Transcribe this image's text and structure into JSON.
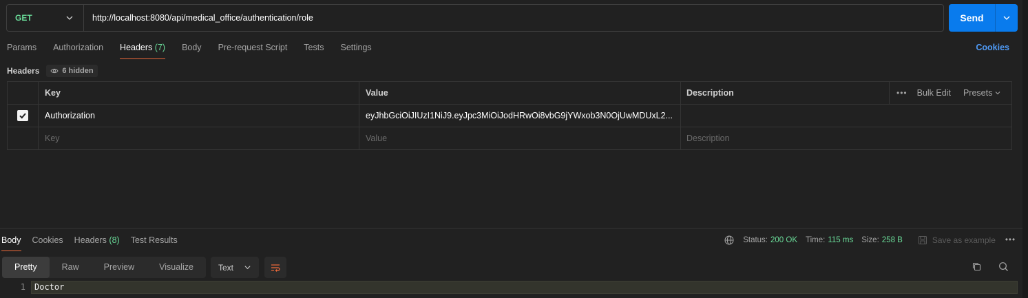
{
  "request": {
    "method": "GET",
    "url": "http://localhost:8080/api/medical_office/authentication/role",
    "send_label": "Send"
  },
  "tabs": [
    {
      "label": "Params"
    },
    {
      "label": "Authorization"
    },
    {
      "label": "Headers",
      "count": "(7)"
    },
    {
      "label": "Body"
    },
    {
      "label": "Pre-request Script"
    },
    {
      "label": "Tests"
    },
    {
      "label": "Settings"
    }
  ],
  "cookies_label": "Cookies",
  "headers_section": {
    "title": "Headers",
    "hidden_badge": "6 hidden",
    "columns": {
      "key": "Key",
      "value": "Value",
      "description": "Description"
    },
    "bulk_edit": "Bulk Edit",
    "presets": "Presets",
    "rows": [
      {
        "checked": true,
        "key": "Authorization",
        "value": "eyJhbGciOiJIUzI1NiJ9.eyJpc3MiOiJodHRwOi8vbG9jYWxob3N0OjUwMDUxL2..."
      }
    ],
    "placeholder": {
      "key": "Key",
      "value": "Value",
      "description": "Description"
    }
  },
  "response": {
    "tabs": [
      {
        "label": "Body"
      },
      {
        "label": "Cookies"
      },
      {
        "label": "Headers",
        "count": "(8)"
      },
      {
        "label": "Test Results"
      }
    ],
    "status_label": "Status:",
    "status_value": "200 OK",
    "time_label": "Time:",
    "time_value": "115 ms",
    "size_label": "Size:",
    "size_value": "258 B",
    "save_example": "Save as example",
    "format_tabs": [
      "Pretty",
      "Raw",
      "Preview",
      "Visualize"
    ],
    "format_select": "Text",
    "body_lines": [
      {
        "num": "1",
        "text": "Doctor"
      }
    ]
  },
  "colors": {
    "accent": "#097bed",
    "success": "#6bdd9a",
    "active_tab": "#f26b3a"
  },
  "icons": [
    "chevron-down-icon",
    "eye-icon",
    "check-icon",
    "globe-icon",
    "save-icon",
    "more-icon",
    "wrap-icon",
    "copy-icon",
    "search-icon"
  ]
}
